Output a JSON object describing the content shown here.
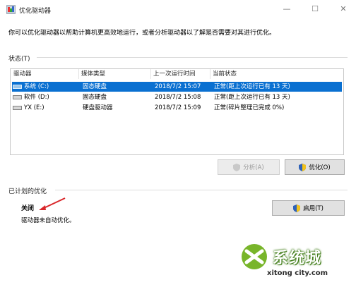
{
  "window": {
    "title": "优化驱动器",
    "min": "—",
    "max": "☐",
    "close": "✕"
  },
  "description": "你可以优化驱动器以帮助计算机更高效地运行，或者分析驱动器以了解是否需要对其进行优化。",
  "status": {
    "label": "状态(T)",
    "columns": [
      "驱动器",
      "媒体类型",
      "上一次运行时间",
      "当前状态"
    ],
    "rows": [
      {
        "drive": "系统 (C:)",
        "media": "固态硬盘",
        "last_run": "2018/7/2 15:07",
        "state": "正常(距上次运行已有 13 天)",
        "selected": true
      },
      {
        "drive": "软件 (D:)",
        "media": "固态硬盘",
        "last_run": "2018/7/2 15:08",
        "state": "正常(距上次运行已有 13 天)",
        "selected": false
      },
      {
        "drive": "YX (E:)",
        "media": "硬盘驱动器",
        "last_run": "2018/7/2 15:09",
        "state": "正常(碎片整理已完成 0%)",
        "selected": false
      }
    ],
    "analyze_label": "分析(A)",
    "optimize_label": "优化(O)"
  },
  "scheduled": {
    "label": "已计划的优化",
    "state": "关闭",
    "note": "驱动器未自动优化。",
    "enable_label": "启用(T)"
  },
  "watermark": {
    "brand": "系统城",
    "url": "xitong city.com"
  },
  "colors": {
    "selection": "#0a70d1",
    "annotation_arrow": "#d9262a"
  }
}
